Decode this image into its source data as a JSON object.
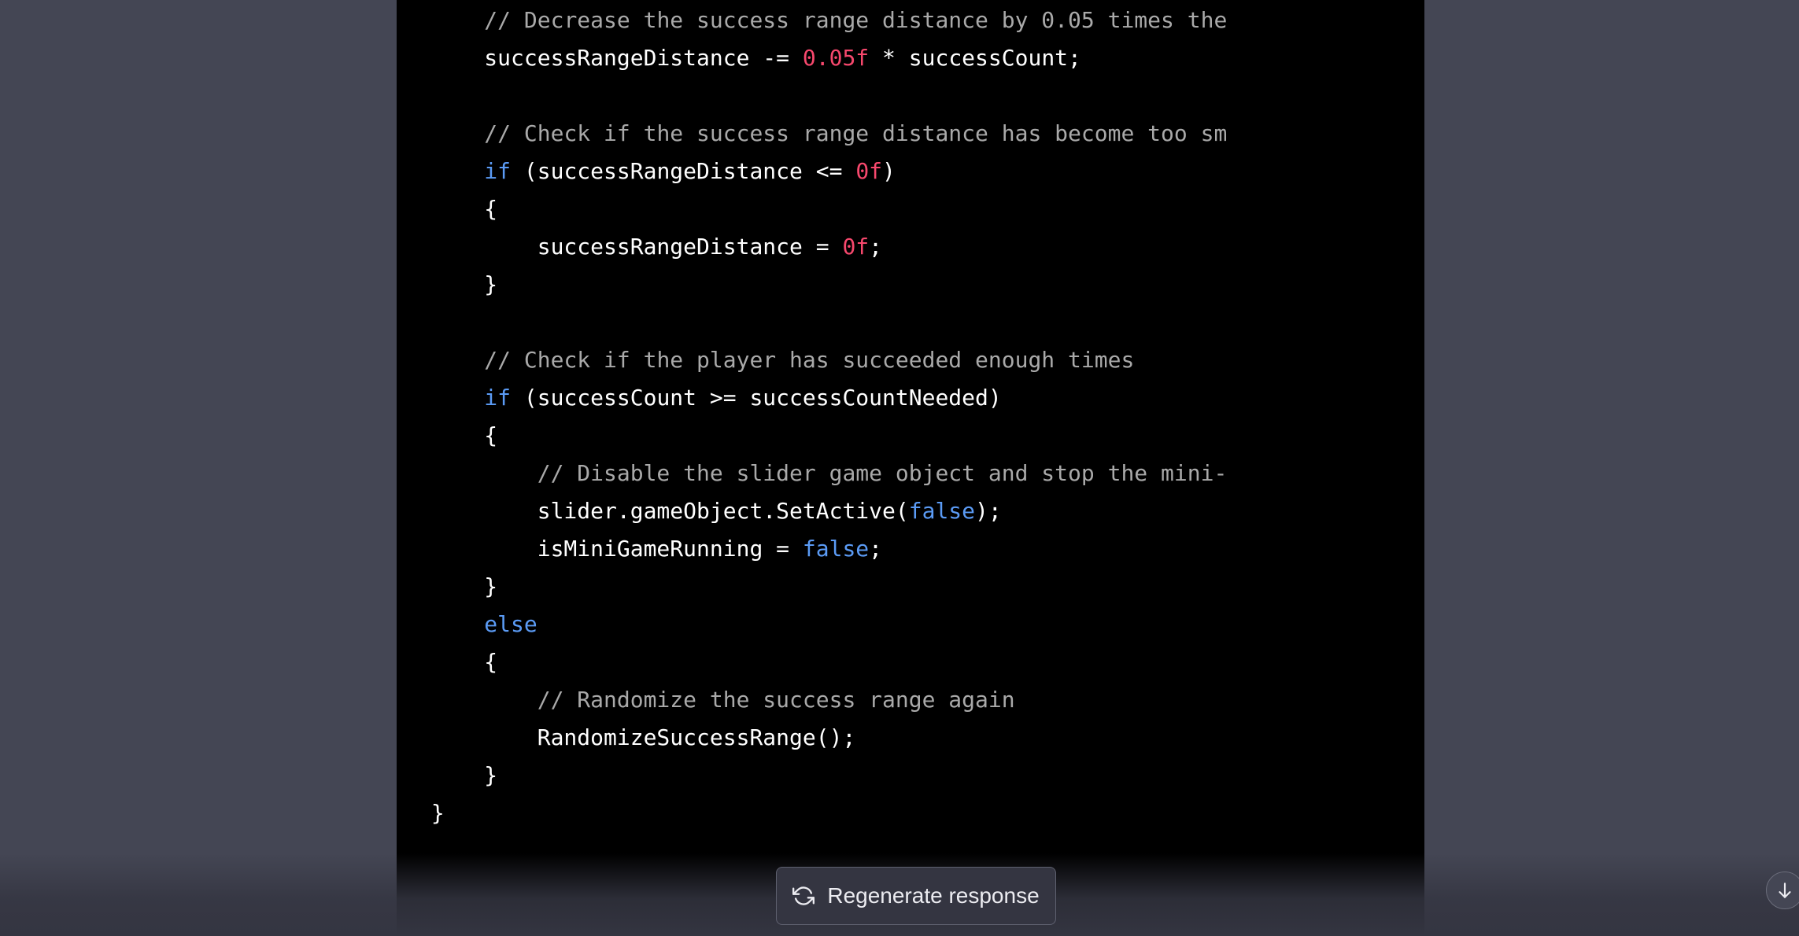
{
  "code": {
    "lines": [
      {
        "indent": "            ",
        "tokens": [
          {
            "type": "comment",
            "text": "// Decrease the success range distance by 0.05 times the"
          }
        ]
      },
      {
        "indent": "            ",
        "tokens": [
          {
            "type": "plain",
            "text": "successRangeDistance -= "
          },
          {
            "type": "number",
            "text": "0.05f"
          },
          {
            "type": "plain",
            "text": " * successCount;"
          }
        ]
      },
      {
        "indent": "",
        "tokens": []
      },
      {
        "indent": "            ",
        "tokens": [
          {
            "type": "comment",
            "text": "// Check if the success range distance has become too sm"
          }
        ]
      },
      {
        "indent": "            ",
        "tokens": [
          {
            "type": "keyword",
            "text": "if"
          },
          {
            "type": "plain",
            "text": " (successRangeDistance <= "
          },
          {
            "type": "number",
            "text": "0f"
          },
          {
            "type": "plain",
            "text": ")"
          }
        ]
      },
      {
        "indent": "            ",
        "tokens": [
          {
            "type": "plain",
            "text": "{"
          }
        ]
      },
      {
        "indent": "                ",
        "tokens": [
          {
            "type": "plain",
            "text": "successRangeDistance = "
          },
          {
            "type": "number",
            "text": "0f"
          },
          {
            "type": "plain",
            "text": ";"
          }
        ]
      },
      {
        "indent": "            ",
        "tokens": [
          {
            "type": "plain",
            "text": "}"
          }
        ]
      },
      {
        "indent": "",
        "tokens": []
      },
      {
        "indent": "            ",
        "tokens": [
          {
            "type": "comment",
            "text": "// Check if the player has succeeded enough times"
          }
        ]
      },
      {
        "indent": "            ",
        "tokens": [
          {
            "type": "keyword",
            "text": "if"
          },
          {
            "type": "plain",
            "text": " (successCount >= successCountNeeded)"
          }
        ]
      },
      {
        "indent": "            ",
        "tokens": [
          {
            "type": "plain",
            "text": "{"
          }
        ]
      },
      {
        "indent": "                ",
        "tokens": [
          {
            "type": "comment",
            "text": "// Disable the slider game object and stop the mini-"
          }
        ]
      },
      {
        "indent": "                ",
        "tokens": [
          {
            "type": "plain",
            "text": "slider.gameObject.SetActive("
          },
          {
            "type": "keyword",
            "text": "false"
          },
          {
            "type": "plain",
            "text": ");"
          }
        ]
      },
      {
        "indent": "                ",
        "tokens": [
          {
            "type": "plain",
            "text": "isMiniGameRunning = "
          },
          {
            "type": "keyword",
            "text": "false"
          },
          {
            "type": "plain",
            "text": ";"
          }
        ]
      },
      {
        "indent": "            ",
        "tokens": [
          {
            "type": "plain",
            "text": "}"
          }
        ]
      },
      {
        "indent": "            ",
        "tokens": [
          {
            "type": "keyword",
            "text": "else"
          }
        ]
      },
      {
        "indent": "            ",
        "tokens": [
          {
            "type": "plain",
            "text": "{"
          }
        ]
      },
      {
        "indent": "                ",
        "tokens": [
          {
            "type": "comment",
            "text": "// Randomize the success range again"
          }
        ]
      },
      {
        "indent": "                ",
        "tokens": [
          {
            "type": "plain",
            "text": "RandomizeSuccessRange();"
          }
        ]
      },
      {
        "indent": "            ",
        "tokens": [
          {
            "type": "plain",
            "text": "}"
          }
        ]
      },
      {
        "indent": "        ",
        "tokens": [
          {
            "type": "plain",
            "text": "}"
          }
        ]
      },
      {
        "indent": "    ",
        "tokens": [
          {
            "type": "plain",
            "text": "}"
          }
        ]
      },
      {
        "indent": "",
        "tokens": [
          {
            "type": "plain",
            "text": "}"
          }
        ]
      },
      {
        "indent": "",
        "tokens": [
          {
            "type": "plain",
            "text": "}"
          }
        ]
      }
    ]
  },
  "footer": {
    "regenerate_label": "Regenerate response",
    "regenerate_icon": "refresh-icon",
    "scroll_icon": "arrow-down-icon"
  },
  "colors": {
    "page_background": "#444654",
    "code_background": "#000000",
    "comment": "#a9a9a9",
    "keyword": "#5b9bf5",
    "number": "#f7486d",
    "plain": "#ffffff"
  }
}
